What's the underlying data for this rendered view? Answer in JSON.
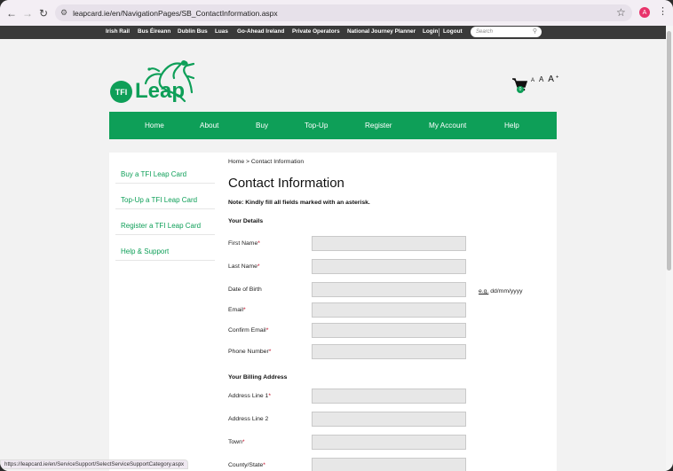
{
  "browser": {
    "url": "leapcard.ie/en/NavigationPages/SB_ContactInformation.aspx",
    "status_url": "https://leapcard.ie/en/ServiceSupport/SelectServiceSupportCategory.aspx",
    "profile_initial": "A"
  },
  "topbar": {
    "links": [
      "Irish Rail",
      "Bus Éireann",
      "Dublin Bus",
      "Luas",
      "Go-Ahead Ireland",
      "Private Operators",
      "National Journey Planner",
      "Login",
      "Logout"
    ],
    "search_placeholder": "Search"
  },
  "header": {
    "logo_prefix": "TFI",
    "logo_word": "Leap",
    "cart_count": "0",
    "text_size_labels": [
      "A",
      "A",
      "A"
    ]
  },
  "mainnav": {
    "items": [
      "Home",
      "About",
      "Buy",
      "Top-Up",
      "Register",
      "My Account",
      "Help"
    ]
  },
  "sidebar": {
    "items": [
      "Buy a TFI Leap Card",
      "Top-Up a TFI Leap Card",
      "Register a TFI Leap Card",
      "Help & Support"
    ]
  },
  "main": {
    "breadcrumb": "Home > Contact Information",
    "title": "Contact Information",
    "note": "Note: Kindly fill all fields marked with an asterisk.",
    "details_heading": "Your Details",
    "fields": [
      {
        "label": "First Name",
        "required": "*"
      },
      {
        "label": "Last Name",
        "required": "*"
      },
      {
        "label": "Date of Birth",
        "required": ""
      },
      {
        "label": "Email",
        "required": "*"
      },
      {
        "label": "Confirm Email",
        "required": "*"
      },
      {
        "label": "Phone Number",
        "required": "*"
      }
    ],
    "dob_hint_prefix": "e.g.",
    "dob_hint": " dd/mm/yyyy",
    "billing_heading": "Your Billing Address",
    "billing_fields": [
      {
        "label": "Address Line 1",
        "required": "*"
      },
      {
        "label": "Address Line 2",
        "required": ""
      },
      {
        "label": "Town",
        "required": "*"
      },
      {
        "label": "County/State",
        "required": "*"
      }
    ]
  },
  "colors": {
    "brand_green": "#0e9f58",
    "required_red": "#c0001c",
    "topbar_bg": "#3a3a3a"
  }
}
